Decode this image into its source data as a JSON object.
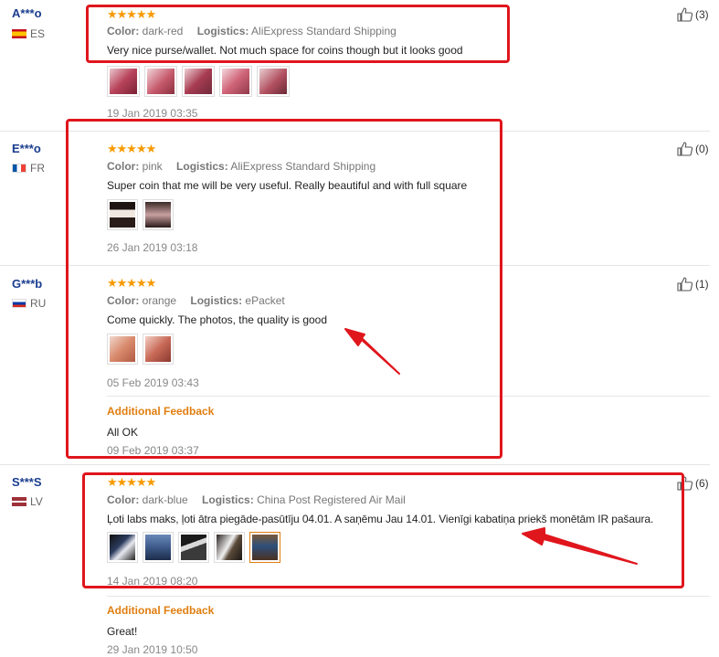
{
  "labels": {
    "color": "Color:",
    "logistics": "Logistics:",
    "additional_feedback": "Additional Feedback"
  },
  "stars": "★★★★★",
  "reviews": [
    {
      "user": "A***o",
      "country": "ES",
      "likes": "(3)",
      "color": "dark-red",
      "logistics": "AliExpress Standard Shipping",
      "text": "Very nice purse/wallet. Not much space for coins though but it looks good",
      "date": "19 Jan 2019 03:35",
      "photos": [
        "#b8435a",
        "#c65a6c",
        "#a83c52",
        "#d06478",
        "#b25060"
      ]
    },
    {
      "user": "E***o",
      "country": "FR",
      "likes": "(0)",
      "color": "pink",
      "logistics": "AliExpress Standard Shipping",
      "text": "Super coin that me will be very useful. Really beautiful and with full square",
      "date": "26 Jan 2019 03:18",
      "photos": [
        "#3a2a28",
        "#4d3a36"
      ]
    },
    {
      "user": "G***b",
      "country": "RU",
      "likes": "(1)",
      "color": "orange",
      "logistics": "ePacket",
      "text": "Come quickly. The photos, the quality is good",
      "date": "05 Feb 2019 03:43",
      "photos": [
        "#d98a6c",
        "#c96a58"
      ],
      "additional_feedback": "All OK",
      "additional_date": "09 Feb 2019 03:37"
    },
    {
      "user": "S***S",
      "country": "LV",
      "likes": "(6)",
      "color": "dark-blue",
      "logistics": "China Post Registered Air Mail",
      "text": "Ļoti labs maks, ļoti ātra piegāde-pasūtīju 04.01. A saņēmu Jau 14.01. Vienīgi kabatiņa priekš monētām IR pašaura.",
      "date": "14 Jan 2019 08:20",
      "photos": [
        "#2b3b5c",
        "#3d5a8a",
        "#4a4a4a",
        "#5a4a3a",
        "#2e4f7a"
      ],
      "additional_feedback": "Great!",
      "additional_date": "29 Jan 2019 10:50"
    }
  ]
}
